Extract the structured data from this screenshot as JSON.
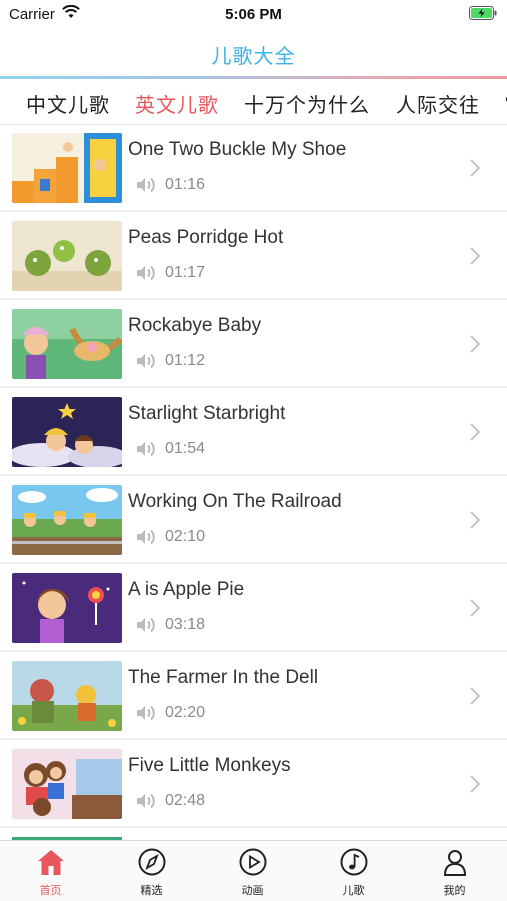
{
  "status_bar": {
    "carrier": "Carrier",
    "time": "5:06 PM"
  },
  "nav": {
    "title": "儿歌大全"
  },
  "tabs": [
    {
      "label": "中文儿歌",
      "active": false
    },
    {
      "label": "英文儿歌",
      "active": true
    },
    {
      "label": "十万个为什么",
      "active": false
    },
    {
      "label": "人际交往",
      "active": false
    }
  ],
  "songs": [
    {
      "title": "One Two Buckle My Shoe",
      "duration": "01:16"
    },
    {
      "title": "Peas Porridge Hot",
      "duration": "01:17"
    },
    {
      "title": "Rockabye Baby",
      "duration": "01:12"
    },
    {
      "title": "Starlight Starbright",
      "duration": "01:54"
    },
    {
      "title": "Working On The Railroad",
      "duration": "02:10"
    },
    {
      "title": "A is Apple Pie",
      "duration": "03:18"
    },
    {
      "title": "The Farmer In the Dell",
      "duration": "02:20"
    },
    {
      "title": "Five Little Monkeys",
      "duration": "02:48"
    }
  ],
  "tab_bar": [
    {
      "label": "首页",
      "icon": "home-icon",
      "active": true
    },
    {
      "label": "精选",
      "icon": "compass-icon",
      "active": false
    },
    {
      "label": "动画",
      "icon": "play-icon",
      "active": false
    },
    {
      "label": "儿歌",
      "icon": "music-note-icon",
      "active": false
    },
    {
      "label": "我的",
      "icon": "person-icon",
      "active": false
    }
  ],
  "colors": {
    "accent": "#3fb0e6",
    "active_tab": "#e8575c",
    "duration_text": "#8a8a8a"
  }
}
